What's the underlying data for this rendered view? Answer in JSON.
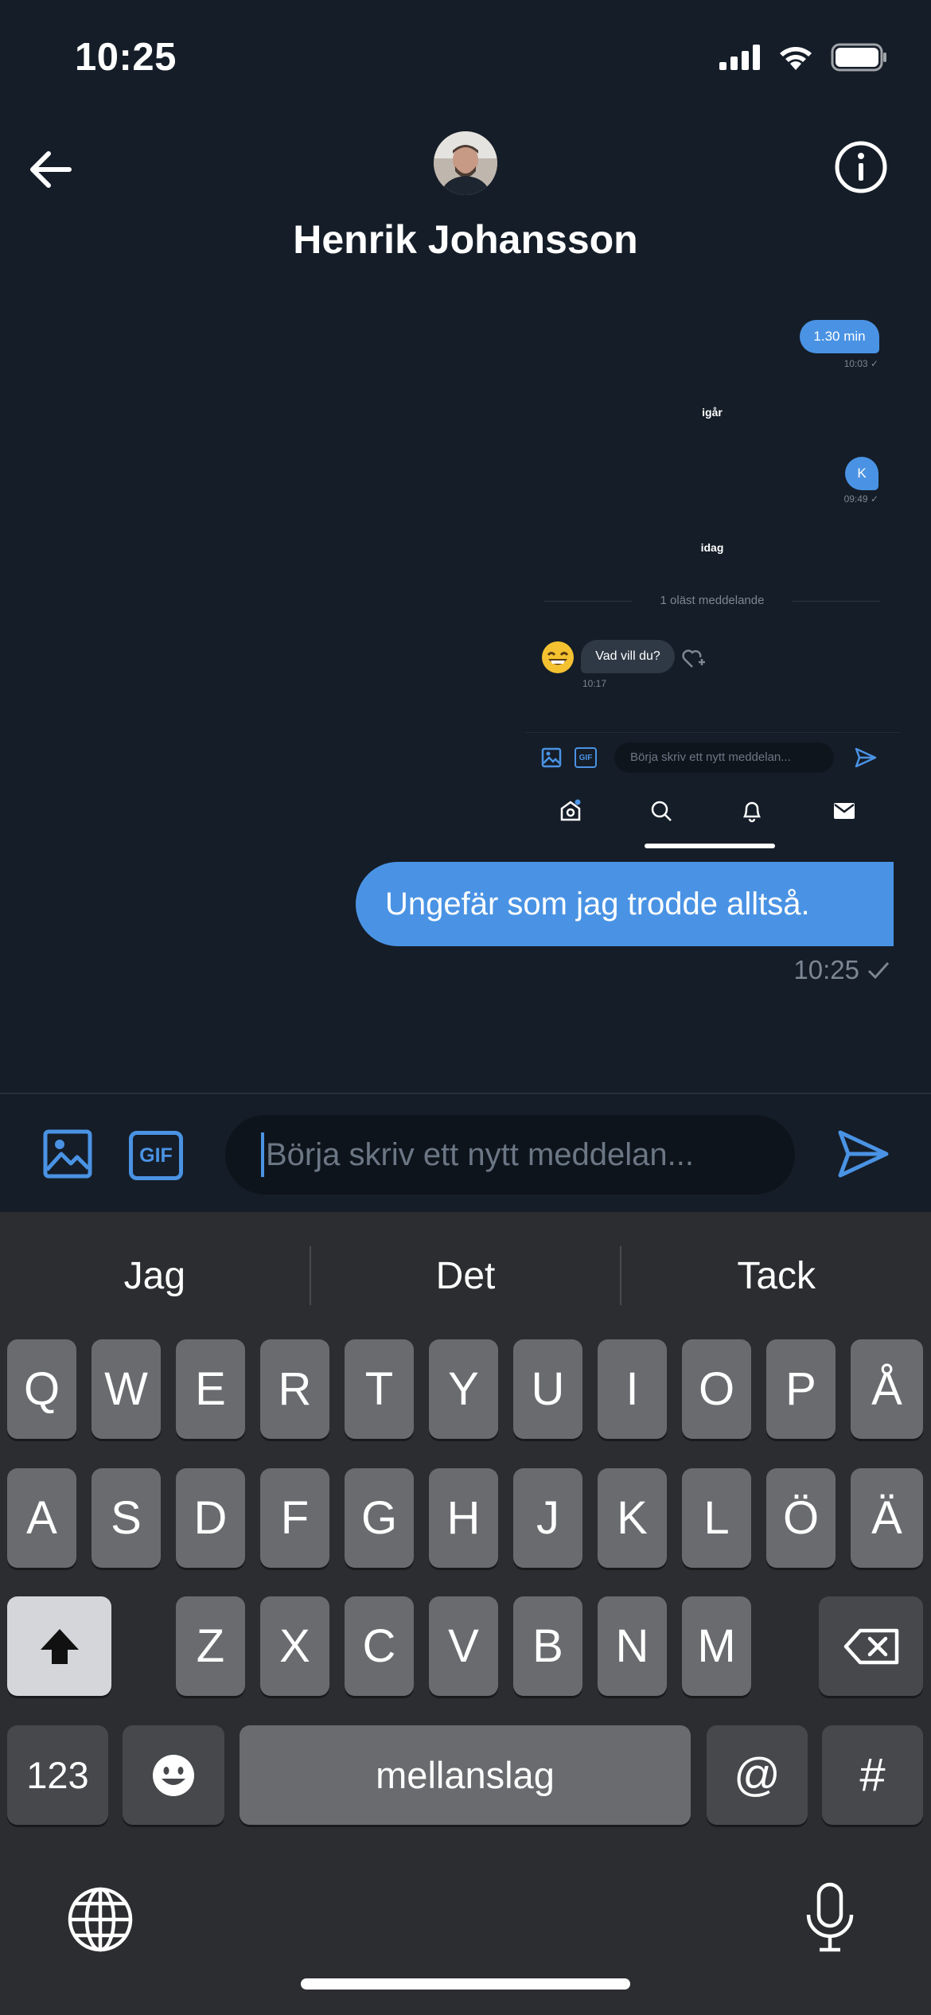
{
  "status_bar": {
    "time": "10:25"
  },
  "header": {
    "contact_name": "Henrik Johansson"
  },
  "embedded_screenshot": {
    "msg_1": {
      "text": "1.30 min",
      "time": "10:03 ✓"
    },
    "day_1": "igår",
    "msg_2": {
      "text": "K",
      "time": "09:49 ✓"
    },
    "day_2": "idag",
    "unread": "1 oläst meddelande",
    "incoming": {
      "text": "Vad vill du?",
      "time": "10:17"
    },
    "composer_placeholder": "Börja skriv ett nytt meddelan..."
  },
  "conversation": {
    "outgoing_text": "Ungefär som jag trodde alltså.",
    "outgoing_time": "10:25"
  },
  "composer": {
    "gif_label": "GIF",
    "placeholder": "Börja skriv ett nytt meddelan..."
  },
  "keyboard": {
    "suggestions": [
      "Jag",
      "Det",
      "Tack"
    ],
    "row1": [
      "Q",
      "W",
      "E",
      "R",
      "T",
      "Y",
      "U",
      "I",
      "O",
      "P",
      "Å"
    ],
    "row2": [
      "A",
      "S",
      "D",
      "F",
      "G",
      "H",
      "J",
      "K",
      "L",
      "Ö",
      "Ä"
    ],
    "row3": [
      "Z",
      "X",
      "C",
      "V",
      "B",
      "N",
      "M"
    ],
    "numbers_label": "123",
    "space_label": "mellanslag",
    "at_label": "@",
    "hash_label": "#"
  },
  "colors": {
    "background": "#151d28",
    "accent": "#4a93e4",
    "keyboard_bg": "#2c2d30",
    "key": "#6a6b6f"
  }
}
